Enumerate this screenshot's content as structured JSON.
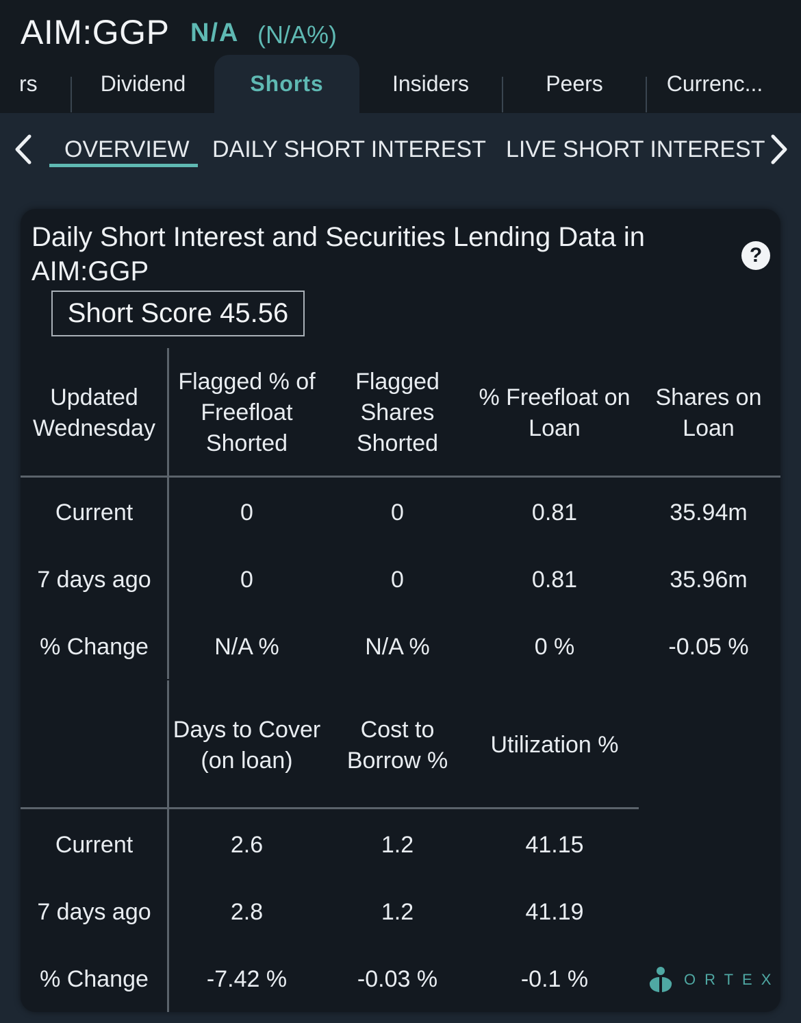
{
  "header": {
    "ticker": "AIM:GGP",
    "price": "N/A",
    "price_change": "(N/A%)"
  },
  "tabs": [
    {
      "label": "rs"
    },
    {
      "label": "Dividend"
    },
    {
      "label": "Shorts",
      "active": true
    },
    {
      "label": "Insiders"
    },
    {
      "label": "Peers"
    },
    {
      "label": "Currenc..."
    }
  ],
  "subtabs": [
    {
      "label": "OVERVIEW",
      "active": true
    },
    {
      "label": "DAILY SHORT INTEREST"
    },
    {
      "label": "LIVE SHORT INTEREST"
    }
  ],
  "card": {
    "title": "Daily Short Interest and Securities Lending Data in AIM:GGP",
    "short_score": "Short Score 45.56",
    "table1": {
      "updated_label": "Updated",
      "updated_day": "Wednesday",
      "headers": [
        "Flagged % of Freefloat Shorted",
        "Flagged Shares Shorted",
        "% Freefloat on Loan",
        "Shares on Loan"
      ],
      "rows": [
        {
          "label": "Current",
          "values": [
            "0",
            "0",
            "0.81",
            "35.94m"
          ]
        },
        {
          "label": "7 days ago",
          "values": [
            "0",
            "0",
            "0.81",
            "35.96m"
          ]
        },
        {
          "label": "% Change",
          "values": [
            "N/A %",
            "N/A %",
            "0 %",
            "-0.05 %"
          ]
        }
      ]
    },
    "table2": {
      "headers": [
        "Days to Cover (on loan)",
        "Cost to Borrow %",
        "Utilization %"
      ],
      "rows": [
        {
          "label": "Current",
          "values": [
            "2.6",
            "1.2",
            "41.15"
          ]
        },
        {
          "label": "7 days ago",
          "values": [
            "2.8",
            "1.2",
            "41.19"
          ]
        },
        {
          "label": "% Change",
          "values": [
            "-7.42 %",
            "-0.03 %",
            "-0.1 %"
          ]
        }
      ]
    },
    "logo_text": "ORTEX"
  },
  "colors": {
    "accent": "#5fb9b3",
    "header_bg": "#141a20",
    "page_bg": "#1d2732",
    "card_bg": "#131920"
  },
  "icons": {
    "back": "chevron-left-icon",
    "forward": "chevron-right-icon",
    "help": "question-circle-icon",
    "logo": "ortex-logo-icon"
  }
}
